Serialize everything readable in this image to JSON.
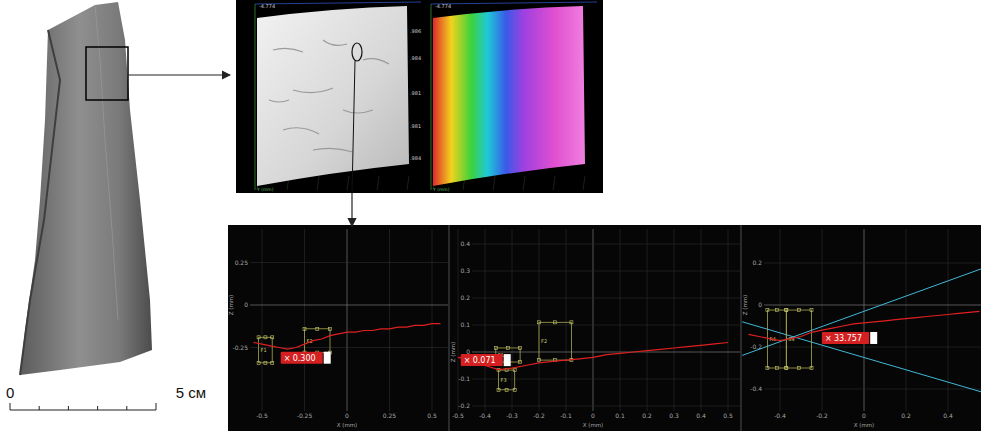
{
  "figure": {
    "photo": {
      "scale_bar": {
        "start": "0",
        "end": "5 см"
      }
    },
    "scan_panel": {
      "views": [
        {
          "kind": "relief",
          "corner_label": "-4.774",
          "ticks": [
            ".986",
            ".984",
            ".981",
            ".981",
            ".984"
          ],
          "axis_label": "Y (mm)"
        },
        {
          "kind": "height-map",
          "corner_label": "-4.774",
          "ticks": [],
          "axis_label": "Y (mm)"
        }
      ]
    },
    "profiles": [
      {
        "x_title": "X (mm)",
        "z_title": "Z (mm)",
        "x_ticks": [
          "-0.5",
          "-0.25",
          "0",
          "0.25",
          "0.5"
        ],
        "z_ticks": [
          "0.25",
          "0",
          "-0.25"
        ],
        "x": [
          -0.55,
          -0.5,
          -0.45,
          -0.4,
          -0.35,
          -0.3,
          -0.25,
          -0.2,
          -0.15,
          -0.1,
          -0.05,
          0,
          0.05,
          0.1,
          0.15,
          0.2,
          0.25,
          0.3,
          0.35,
          0.4,
          0.45,
          0.5,
          0.55
        ],
        "z": [
          -0.22,
          -0.23,
          -0.24,
          -0.25,
          -0.26,
          -0.25,
          -0.23,
          -0.21,
          -0.2,
          -0.18,
          -0.17,
          -0.16,
          -0.16,
          -0.15,
          -0.15,
          -0.14,
          -0.14,
          -0.13,
          -0.13,
          -0.12,
          -0.12,
          -0.11,
          -0.11
        ],
        "markers": [
          {
            "label": "F1",
            "x1": -0.52,
            "z1": -0.19,
            "x2": -0.44,
            "z2": -0.34
          },
          {
            "label": "F2",
            "x1": -0.25,
            "z1": -0.14,
            "x2": -0.1,
            "z2": -0.28
          }
        ],
        "badge": {
          "close": "×",
          "text": "0.300",
          "x": -0.39,
          "z": -0.31
        },
        "guides": []
      },
      {
        "x_title": "X (mm)",
        "z_title": "Z (mm)",
        "x_ticks": [
          "-0.5",
          "-0.4",
          "-0.3",
          "-0.2",
          "-0.1",
          "0",
          "0.1",
          "0.2",
          "0.3",
          "0.4",
          "0.5"
        ],
        "z_ticks": [
          "0.4",
          "0.3",
          "0.2",
          "0.1",
          "0",
          "-0.1",
          "-0.2"
        ],
        "x": [
          -0.5,
          -0.45,
          -0.4,
          -0.35,
          -0.3,
          -0.25,
          -0.2,
          -0.15,
          -0.1,
          -0.05,
          0,
          0.05,
          0.1,
          0.15,
          0.2,
          0.25,
          0.3,
          0.35,
          0.4,
          0.45,
          0.5
        ],
        "z": [
          -0.02,
          -0.03,
          -0.05,
          -0.065,
          -0.06,
          -0.05,
          -0.04,
          -0.035,
          -0.03,
          -0.025,
          -0.02,
          -0.01,
          -0.005,
          0,
          0.005,
          0.01,
          0.015,
          0.02,
          0.025,
          0.03,
          0.035
        ],
        "markers": [
          {
            "label": "F1",
            "x1": -0.36,
            "z1": 0.015,
            "x2": -0.27,
            "z2": -0.037
          },
          {
            "label": "F2",
            "x1": -0.2,
            "z1": 0.11,
            "x2": -0.08,
            "z2": -0.03
          },
          {
            "label": "F3",
            "x1": -0.35,
            "z1": -0.067,
            "x2": -0.29,
            "z2": -0.14
          }
        ],
        "badge": {
          "close": "×",
          "text": "0.071",
          "x": -0.49,
          "z": -0.03
        },
        "guides": []
      },
      {
        "x_title": "X (mm)",
        "z_title": "Z (mm)",
        "x_ticks": [
          "-0.4",
          "-0.2",
          "0",
          "0.2",
          "0.4"
        ],
        "z_ticks": [
          "0.2",
          "0",
          "-0.2",
          "-0.4"
        ],
        "x": [
          -0.55,
          -0.5,
          -0.45,
          -0.4,
          -0.35,
          -0.3,
          -0.25,
          -0.2,
          -0.15,
          -0.1,
          -0.05,
          0,
          0.05,
          0.1,
          0.15,
          0.2,
          0.25,
          0.3,
          0.35,
          0.4,
          0.45,
          0.5,
          0.55
        ],
        "z": [
          -0.14,
          -0.15,
          -0.16,
          -0.17,
          -0.16,
          -0.15,
          -0.13,
          -0.12,
          -0.11,
          -0.1,
          -0.09,
          -0.085,
          -0.08,
          -0.075,
          -0.07,
          -0.065,
          -0.06,
          -0.055,
          -0.05,
          -0.045,
          -0.04,
          -0.035,
          -0.03
        ],
        "markers": [
          {
            "label": "R4",
            "x1": -0.46,
            "z1": -0.024,
            "x2": -0.37,
            "z2": -0.3
          },
          {
            "label": "S4",
            "x1": -0.37,
            "z1": -0.024,
            "x2": -0.25,
            "z2": -0.3
          }
        ],
        "badge": {
          "close": "×",
          "text": "33.757",
          "x": -0.2,
          "z": -0.157
        },
        "guides": [
          {
            "x1": -0.58,
            "z1": -0.24,
            "x2": 0.58,
            "z2": 0.18
          },
          {
            "x1": -0.58,
            "z1": -0.08,
            "x2": 0.58,
            "z2": -0.42
          }
        ]
      }
    ]
  }
}
